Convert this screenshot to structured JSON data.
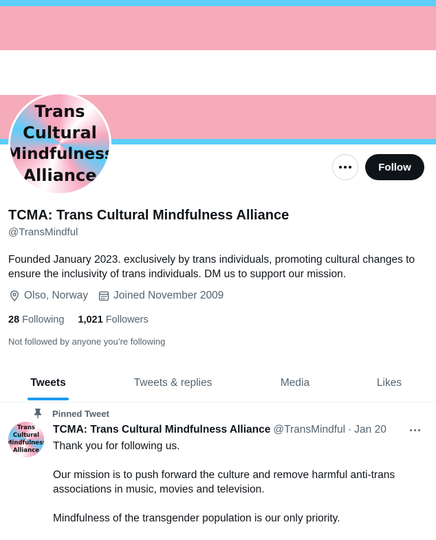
{
  "colors": {
    "trans_blue": "#5bcefa",
    "trans_pink": "#f5abb9",
    "follow_bg": "#0f1419",
    "accent": "#1d9bf0",
    "muted": "#536471"
  },
  "profile": {
    "avatar_lines": [
      "Trans",
      "Cultural",
      "Mindfulness",
      "Alliance"
    ],
    "name": "TCMA: Trans Cultural Mindfulness Alliance",
    "handle": "@TransMindful",
    "bio": "Founded January 2023. exclusively by trans individuals, promoting cultural changes to ensure the inclusivity of trans individuals. DM us to support our mission.",
    "location": "Olso, Norway",
    "joined": "Joined November 2009",
    "following_count": "28",
    "following_label": "Following",
    "followers_count": "1,021",
    "followers_label": "Followers",
    "not_followed": "Not followed by anyone you’re following",
    "follow_label": "Follow",
    "more_icon": "more-horizontal-icon"
  },
  "tabs": [
    {
      "label": "Tweets",
      "active": true
    },
    {
      "label": "Tweets & replies",
      "active": false
    },
    {
      "label": "Media",
      "active": false
    },
    {
      "label": "Likes",
      "active": false
    }
  ],
  "pinned_tweet": {
    "pinned_label": "Pinned Tweet",
    "author_name": "TCMA: Trans Cultural Mindfulness Alliance",
    "author_handle": "@TransMindful",
    "date_sep": "·",
    "date": "Jan 20",
    "paragraphs": [
      "Thank you for following us.",
      "Our mission is to push forward the culture and remove harmful anti-trans associations in music, movies and television.",
      "Mindfulness of the transgender population is our only priority."
    ]
  }
}
